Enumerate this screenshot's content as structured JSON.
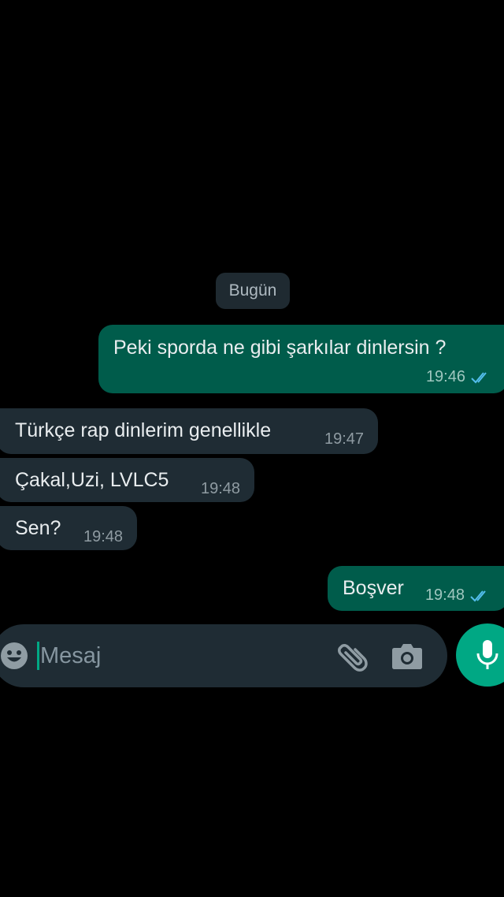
{
  "chat": {
    "date_divider": "Bugün",
    "messages": [
      {
        "direction": "outgoing",
        "text": "Peki sporda ne gibi şarkılar dinlersin ?",
        "time": "19:46",
        "status": "read"
      },
      {
        "direction": "incoming",
        "text": "Türkçe rap dinlerim genellikle",
        "time": "19:47"
      },
      {
        "direction": "incoming",
        "text": "Çakal,Uzi, LVLC5",
        "time": "19:48"
      },
      {
        "direction": "incoming",
        "text": "Sen?",
        "time": "19:48"
      },
      {
        "direction": "outgoing",
        "text": "Boşver",
        "time": "19:48",
        "status": "read"
      }
    ]
  },
  "composer": {
    "placeholder": "Mesaj",
    "value": "",
    "icons": {
      "emoji": "emoji-icon",
      "attach": "paperclip-icon",
      "camera": "camera-icon",
      "mic": "microphone-icon"
    }
  },
  "colors": {
    "background": "#000000",
    "outgoing_bubble": "#005c4b",
    "incoming_bubble": "#1f2c34",
    "accent": "#00a884",
    "read_ticks": "#53bdeb"
  }
}
